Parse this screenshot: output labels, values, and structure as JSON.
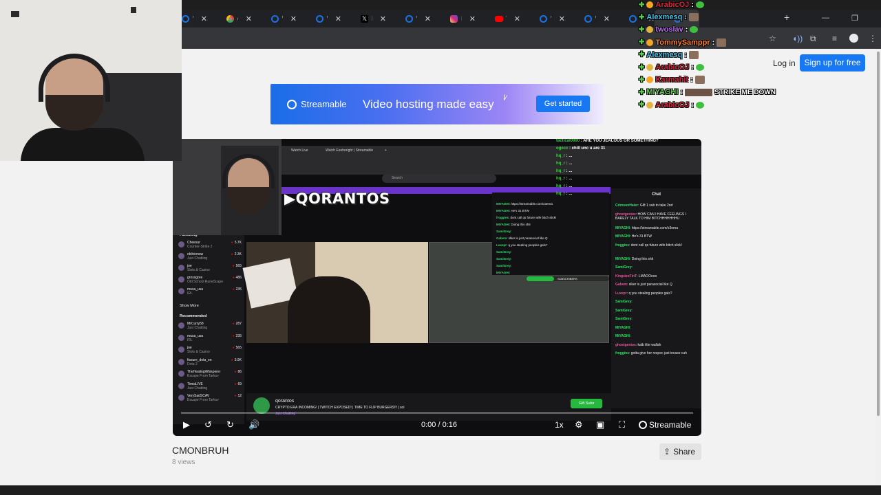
{
  "browser": {
    "tabs": [
      {
        "label": "Watc",
        "icon": "streamable-icon"
      },
      {
        "label": "chro",
        "icon": "chrome-icon"
      },
      {
        "label": "Watc",
        "icon": "streamable-icon"
      },
      {
        "label": "Watc",
        "icon": "streamable-icon"
      },
      {
        "label": "Hom",
        "icon": "x-icon"
      },
      {
        "label": "Watc",
        "icon": "streamable-icon"
      },
      {
        "label": "Insta",
        "icon": "instagram-icon"
      },
      {
        "label": "This",
        "icon": "youtube-icon"
      },
      {
        "label": "Watc",
        "icon": "streamable-icon"
      },
      {
        "label": "Watc",
        "icon": "streamable-icon"
      },
      {
        "label": "Watc",
        "icon": "streamable-icon"
      },
      {
        "label": "Watc",
        "icon": "streamable-icon"
      }
    ],
    "new_tab": "+",
    "window_controls": [
      "—",
      "❐",
      "✕"
    ]
  },
  "header": {
    "login": "Log in",
    "signup": "Sign up for free"
  },
  "banner": {
    "brand": "Streamable",
    "headline": "Video hosting made easy",
    "cta": "Get started"
  },
  "video": {
    "time": "0:00 / 0:16",
    "speed": "1x",
    "progress": 0.0,
    "watermark": "Streamable"
  },
  "inner_stream": {
    "logo_text": "QORANTOS",
    "search_placeholder": "Search",
    "chat_header": "Chat",
    "subscribers_label": "SUBSCRIBERS",
    "streamer_name": "qorantos",
    "stream_title": "CRYPTO ERA INCOMING! | TWITCH EXPOSED! | TIME TO FLIP BURGERS!!! | sol",
    "stream_category": "Just Chatting",
    "gift_button": "Gift Subs",
    "following_header": "Following",
    "recommended_header": "Recommended",
    "show_more": "Show More",
    "following": [
      {
        "name": "Cheesur",
        "sub": "Counter-Strike 2",
        "viewers": "5.7K"
      },
      {
        "name": "oblivionsw",
        "sub": "Just Chatting",
        "viewers": "2.3K"
      },
      {
        "name": "joe",
        "sub": "Slots & Casino",
        "viewers": "565"
      },
      {
        "name": "grossgore",
        "sub": "Old School RuneScape",
        "viewers": "486"
      },
      {
        "name": "musa_usa",
        "sub": "IRL",
        "viewers": "235"
      }
    ],
    "recommended": [
      {
        "name": "MrCurry58",
        "sub": "Just Chatting",
        "viewers": "287"
      },
      {
        "name": "musa_usa",
        "sub": "IRL",
        "viewers": "235"
      },
      {
        "name": "joe",
        "sub": "Slots & Casino",
        "viewers": "565"
      },
      {
        "name": "fissure_dota_en",
        "sub": "Dota 2",
        "viewers": "3.9K"
      },
      {
        "name": "TheHealingWhisperer",
        "sub": "Escape From Tarkov",
        "viewers": "86"
      },
      {
        "name": "TimiaLIVE",
        "sub": "Just Chatting",
        "viewers": "69"
      },
      {
        "name": "VerySadSCAV",
        "sub": "Escape From Tarkov",
        "viewers": "12"
      }
    ],
    "top_chat": [
      {
        "user": "tactical0000",
        "text": "ARE YOU JEALOUS OR SOMETHING?"
      },
      {
        "user": "ogecc",
        "text": "chill unc u are 31"
      },
      {
        "user": "hq_r",
        "text": "..."
      },
      {
        "user": "hq_r",
        "text": "..."
      },
      {
        "user": "hq_r",
        "text": "..."
      },
      {
        "user": "hq_r",
        "text": "..."
      },
      {
        "user": "hq_r",
        "text": "..."
      },
      {
        "user": "hq_r",
        "text": "..."
      }
    ],
    "mid_chat": [
      {
        "user": "MIYAGHI",
        "text": "https://streamable.com/o3ema"
      },
      {
        "user": "MIYAGHI",
        "text": "He's 31 BTW"
      },
      {
        "user": "froggins",
        "text": "dont call qs future wife bitch slick!"
      },
      {
        "user": "MIYAGHI",
        "text": "Doing this shit"
      },
      {
        "user": "SamiGrey",
        "text": ""
      },
      {
        "user": "Gabem",
        "text": "slker is just parasocial like Q"
      },
      {
        "user": "Luxepr",
        "text": "q you stealing peoples gals?"
      },
      {
        "user": "SamiGrey",
        "text": ""
      },
      {
        "user": "SamiGrey",
        "text": ""
      },
      {
        "user": "SamiGrey",
        "text": ""
      },
      {
        "user": "MIYAGHI",
        "text": ""
      }
    ],
    "side_chat": [
      {
        "user": "CrimsonHater",
        "text": "Gift 1 sub to take 2nd"
      },
      {
        "user": "ghostgenius",
        "text": "HOW CAN I HAVE FEELINGS I BARELY TALK TO HIM BITCHHHHHHHU"
      },
      {
        "user": "MIYAGHI",
        "text": "https://streamable.com/o3ema"
      },
      {
        "user": "MIYAGHI",
        "text": "He's 31 BTW"
      },
      {
        "user": "froggins",
        "text": "dont call qs future wife bitch slick!"
      },
      {
        "user": "MIYAGHI",
        "text": "Doing this shit"
      },
      {
        "user": "SamiGrey",
        "text": ""
      },
      {
        "user": "KingsizeFinT",
        "text": "LMAOOooo"
      },
      {
        "user": "Gabem",
        "text": "slker is just parasocial like Q"
      },
      {
        "user": "Luxepr",
        "text": "q you stealing peoples gals?"
      },
      {
        "user": "SamiGrey",
        "text": ""
      },
      {
        "user": "SamiGrey",
        "text": ""
      },
      {
        "user": "SamiGrey",
        "text": ""
      },
      {
        "user": "MIYAGHI",
        "text": ""
      },
      {
        "user": "MIYAGHI",
        "text": ""
      },
      {
        "user": "ghostgenius",
        "text": "kalb iitte wallah"
      },
      {
        "user": "froggins",
        "text": "gotta give her respec just incase cuh"
      }
    ]
  },
  "video_meta": {
    "title": "CMONBRUH",
    "views": "8 views",
    "share": "Share"
  },
  "overlay_chat": [
    {
      "user": "ArabicOJ",
      "color": "#e0243b",
      "emote": "green"
    },
    {
      "user": "Alexmesq",
      "color": "#45c2e8",
      "emote": "face"
    },
    {
      "user": "twoslav",
      "color": "#bd6bf5",
      "emote": "green"
    },
    {
      "user": "TommySamppr",
      "color": "#ff7f2a",
      "emote": "face"
    },
    {
      "user": "Alexmesq",
      "color": "#45c2e8",
      "emote": "face"
    },
    {
      "user": "ArabicOJ",
      "color": "#e0243b",
      "emote": "green"
    },
    {
      "user": "Karmahit",
      "color": "#e0243b",
      "emote": "face"
    },
    {
      "user": "MIYAGHI",
      "color": "#6bd15a",
      "emote": "wide",
      "text": "STRIKE ME DOWN"
    },
    {
      "user": "ArabicOJ",
      "color": "#e0243b",
      "emote": "green"
    }
  ]
}
